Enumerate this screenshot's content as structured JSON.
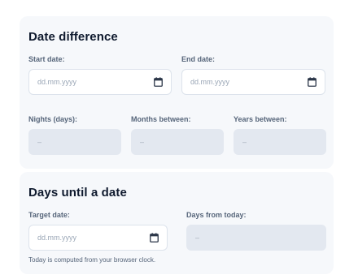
{
  "date_difference": {
    "title": "Date difference",
    "start_label": "Start date:",
    "start_placeholder": "dd.mm.yyyy",
    "end_label": "End date:",
    "end_placeholder": "dd.mm.yyyy",
    "nights_label": "Nights (days):",
    "nights_value": "–",
    "months_label": "Months between:",
    "months_value": "–",
    "years_label": "Years between:",
    "years_value": "–"
  },
  "days_until": {
    "title": "Days until a date",
    "target_label": "Target date:",
    "target_placeholder": "dd.mm.yyyy",
    "days_label": "Days from today:",
    "days_value": "–",
    "note": "Today is computed from your browser clock."
  },
  "icons": {
    "calendar": "calendar-icon"
  }
}
